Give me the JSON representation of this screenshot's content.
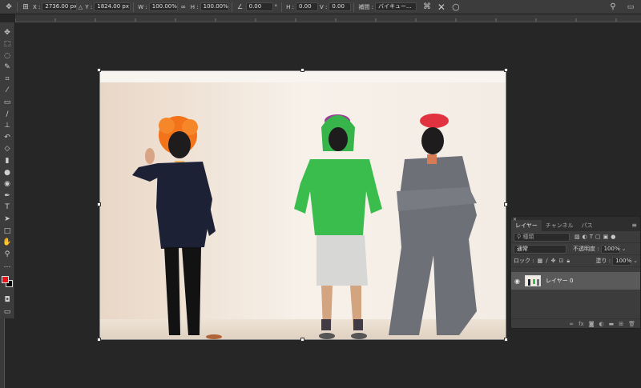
{
  "options_bar": {
    "ref_point_icon": "reference-point-icon",
    "x_label": "X :",
    "x_value": "2736.00 px",
    "y_label": "Y :",
    "y_value": "1824.00 px",
    "w_label": "W :",
    "w_value": "100.00%",
    "link_icon": "link-icon",
    "h_label": "H :",
    "h_value": "100.00%",
    "angle_icon": "angle-icon",
    "angle_value": "0.00",
    "angle_unit": "°",
    "hskew_label": "H :",
    "hskew_value": "0.00",
    "vskew_label": "V :",
    "vskew_value": "0.00",
    "interp_label": "補間 :",
    "interp_value": "バイキュー...",
    "warp_icon": "warp-icon",
    "cancel_icon": "cancel-icon",
    "commit_icon": "commit-icon",
    "search_icon": "search-icon",
    "workspace_icon": "workspace-icon"
  },
  "layers_panel": {
    "tabs": [
      "レイヤー",
      "チャンネル",
      "パス"
    ],
    "active_tab": 0,
    "filter_placeholder": "種類",
    "blend_mode": "通常",
    "opacity_label": "不透明度 :",
    "opacity_value": "100%",
    "lock_label": "ロック :",
    "fill_label": "塗り :",
    "fill_value": "100%",
    "layers": [
      {
        "name": "レイヤー 0",
        "visible": true,
        "selected": true
      }
    ]
  },
  "toolbar": {
    "foreground_color": "#e8141b",
    "background_color": "#000000"
  }
}
